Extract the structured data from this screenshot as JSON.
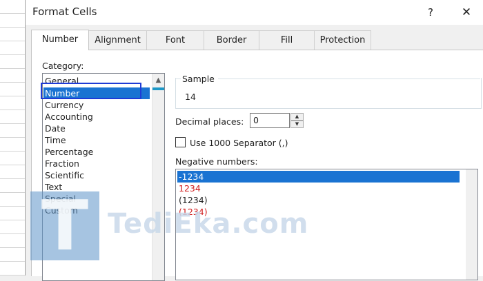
{
  "window": {
    "title": "Format Cells",
    "help_label": "?",
    "close_label": "✕"
  },
  "tabs": [
    {
      "label": "Number",
      "active": true
    },
    {
      "label": "Alignment",
      "active": false
    },
    {
      "label": "Font",
      "active": false
    },
    {
      "label": "Border",
      "active": false
    },
    {
      "label": "Fill",
      "active": false
    },
    {
      "label": "Protection",
      "active": false
    }
  ],
  "category": {
    "label": "Category:",
    "selected": "Number",
    "items": [
      "General",
      "Number",
      "Currency",
      "Accounting",
      "Date",
      "Time",
      "Percentage",
      "Fraction",
      "Scientific",
      "Text",
      "Special",
      "Custom"
    ]
  },
  "sample": {
    "label": "Sample",
    "value": "14"
  },
  "decimal_places": {
    "label": "Decimal places:",
    "value": "0"
  },
  "separator": {
    "label": "Use 1000 Separator (,)",
    "checked": false
  },
  "negative_numbers": {
    "label": "Negative numbers:",
    "items": [
      {
        "text": "-1234",
        "color": "#000000",
        "selected": true
      },
      {
        "text": "1234",
        "color": "#d11a1a",
        "selected": false
      },
      {
        "text": "(1234)",
        "color": "#222222",
        "selected": false
      },
      {
        "text": "(1234)",
        "color": "#d11a1a",
        "selected": false
      }
    ]
  },
  "watermark": {
    "letter": "T",
    "text": "TediEka.com"
  },
  "colors": {
    "selection": "#1a73d2",
    "highlight_box": "#1f3bd6",
    "negative_red": "#d11a1a"
  }
}
